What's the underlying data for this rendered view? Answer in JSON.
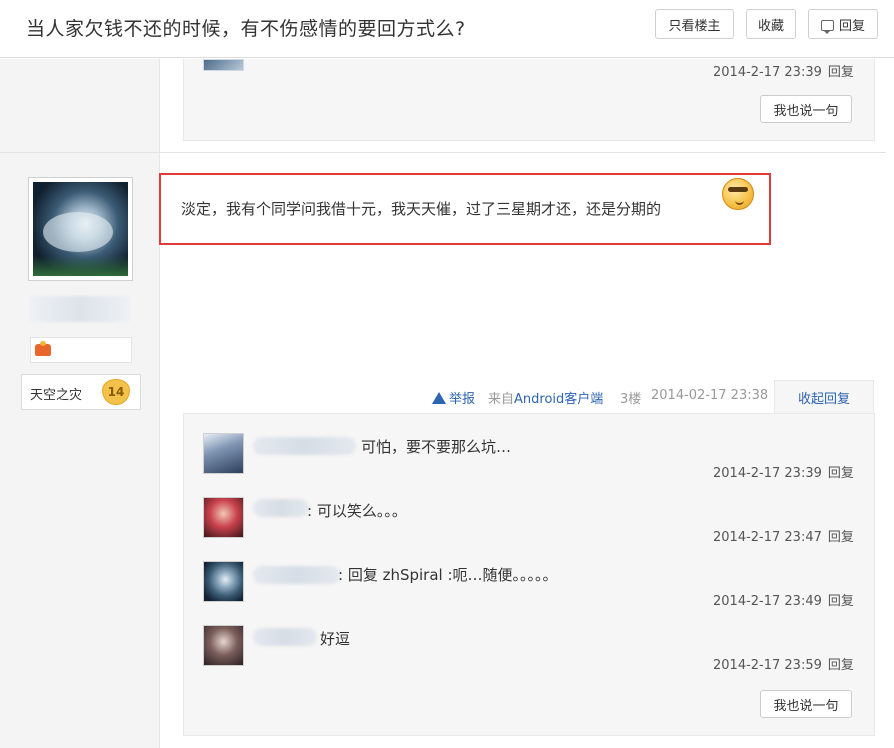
{
  "header": {
    "title": "当人家欠钱不还的时候，有不伤感情的要回方式么?",
    "buttons": {
      "only_op": "只看楼主",
      "favorite": "收藏",
      "reply": "回复"
    }
  },
  "prev_floor": {
    "last_reply_time": "2014-2-17 23:39",
    "reply_label": "回复",
    "say_button": "我也说一句"
  },
  "post": {
    "level_name": "天空之灾",
    "level": "14",
    "content": "淡定，我有个同学问我借十元，我天天催，过了三星期才还，还是分期的",
    "report": "举报",
    "from_prefix": "来自",
    "from_client": "Android客户端",
    "floor": "3楼",
    "time": "2014-02-17 23:38",
    "collapse": "收起回复"
  },
  "replies": [
    {
      "content": "可怕，要不要那么坑…",
      "time": "2014-2-17 23:39",
      "reply_label": "回复"
    },
    {
      "content": ": 可以笑么。。。",
      "time": "2014-2-17 23:47",
      "reply_label": "回复"
    },
    {
      "content": ": 回复 zhSpiral :呃…随便。。。。。",
      "time": "2014-2-17 23:49",
      "reply_label": "回复"
    },
    {
      "content": "好逗",
      "time": "2014-2-17 23:59",
      "reply_label": "回复"
    }
  ],
  "say_button": "我也说一句",
  "colors": {
    "link": "#2d64b3",
    "highlight": "#e03a3a",
    "sidebar": "#f4f4f4"
  }
}
